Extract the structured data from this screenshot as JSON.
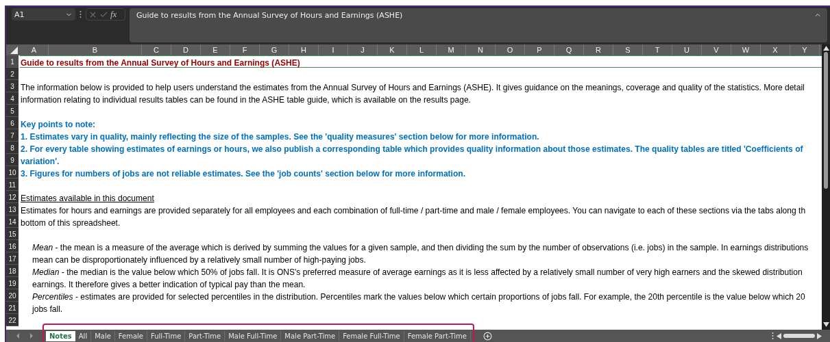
{
  "formula_bar": {
    "name_box": "A1",
    "function_label": "fx",
    "formula": "Guide to results from the Annual Survey of Hours and Earnings (ASHE)"
  },
  "columns": [
    "A",
    "B",
    "C",
    "D",
    "E",
    "F",
    "G",
    "H",
    "I",
    "J",
    "K",
    "L",
    "M",
    "N",
    "O",
    "P",
    "Q",
    "R",
    "S",
    "T",
    "U",
    "V",
    "W",
    "X",
    "Y"
  ],
  "rows": [
    {
      "number": "1",
      "kind": "title",
      "selected": true,
      "text": "Guide to results from the Annual Survey of Hours and Earnings (ASHE)"
    },
    {
      "number": "2",
      "kind": "empty",
      "selected": false
    },
    {
      "number": "3",
      "kind": "body",
      "selected": false,
      "text": "The information below is provided to help users understand the estimates from the Annual Survey of Hours and Earnings (ASHE). It gives guidance on the meanings, coverage and quality of the statistics. More detail"
    },
    {
      "number": "4",
      "kind": "body",
      "selected": false,
      "text": "information relating to individual results tables can be found in the ASHE table guide, which is available on the results page."
    },
    {
      "number": "5",
      "kind": "empty",
      "selected": false
    },
    {
      "number": "6",
      "kind": "key",
      "selected": false,
      "text": "Key points to note:"
    },
    {
      "number": "7",
      "kind": "key",
      "selected": false,
      "text": "1. Estimates vary in quality, mainly reflecting the size of the samples. See the 'quality measures' section below for more information."
    },
    {
      "number": "8",
      "kind": "key",
      "selected": false,
      "text": "2. For every table showing estimates of earnings or hours, we also publish a corresponding table which provides quality information about those estimates. The quality tables are titled 'Coefficients of"
    },
    {
      "number": "9",
      "kind": "key",
      "selected": false,
      "text": "variation'."
    },
    {
      "number": "10",
      "kind": "key",
      "selected": false,
      "text": "3. Figures for numbers of jobs are not reliable estimates. See the 'job counts' section below for more information."
    },
    {
      "number": "11",
      "kind": "empty",
      "selected": false
    },
    {
      "number": "12",
      "kind": "heading",
      "selected": false,
      "text": "Estimates available in this document"
    },
    {
      "number": "13",
      "kind": "body",
      "selected": false,
      "text": "Estimates for hours and earnings are provided separately for all employees and each combination of full-time / part-time and male / female employees. You can navigate to each of these sections via the tabs along th"
    },
    {
      "number": "14",
      "kind": "body",
      "selected": false,
      "text": "bottom of this spreadsheet."
    },
    {
      "number": "15",
      "kind": "empty",
      "selected": false
    },
    {
      "number": "16",
      "kind": "definition",
      "selected": false,
      "text": "*Mean*  - the mean is a measure of the average which is derived by summing the values for a given sample, and then dividing the sum by the number of observations (i.e. jobs) in the sample. In earnings distributions"
    },
    {
      "number": "17",
      "kind": "definition",
      "selected": false,
      "text": "mean can be disproportionately influenced by a relatively small number of high-paying jobs."
    },
    {
      "number": "18",
      "kind": "definition",
      "selected": false,
      "text": "*Median*  - the median is the value below which 50% of jobs fall. It is ONS's preferred measure of average earnings as it is less affected by a relatively small number of very high earners and the skewed distribution"
    },
    {
      "number": "19",
      "kind": "definition",
      "selected": false,
      "text": "earnings. It therefore gives a better indication of typical pay than the mean."
    },
    {
      "number": "20",
      "kind": "definition",
      "selected": false,
      "text": "*Percentiles*  - estimates are provided for selected percentiles in the distribution. Percentiles mark the values below which certain proportions of jobs fall. For example, the 20th percentile is the value below which 20"
    },
    {
      "number": "21",
      "kind": "definition",
      "selected": false,
      "text": "jobs fall."
    },
    {
      "number": "22",
      "kind": "empty",
      "selected": false
    }
  ],
  "sheet_tabs": {
    "highlight": true,
    "tabs": [
      {
        "label": "Notes",
        "selected": true
      },
      {
        "label": "All",
        "selected": false
      },
      {
        "label": "Male",
        "selected": false
      },
      {
        "label": "Female",
        "selected": false
      },
      {
        "label": "Full-Time",
        "selected": false
      },
      {
        "label": "Part-Time",
        "selected": false
      },
      {
        "label": "Male Full-Time",
        "selected": false
      },
      {
        "label": "Male Part-Time",
        "selected": false
      },
      {
        "label": "Female Full-Time",
        "selected": false
      },
      {
        "label": "Female Part-Time",
        "selected": false
      }
    ]
  }
}
